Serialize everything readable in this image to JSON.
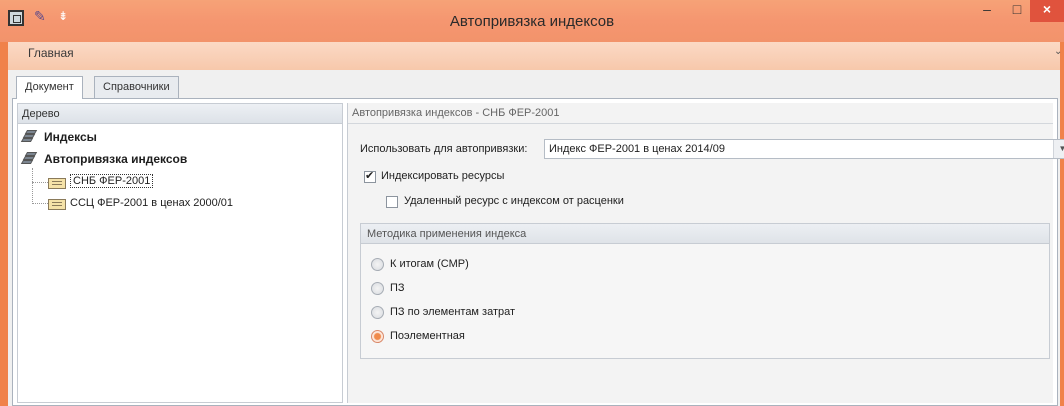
{
  "window": {
    "title": "Автопривязка индексов",
    "ribbon_tab": "Главная",
    "minimize": "–",
    "maximize": "□",
    "close": "×"
  },
  "doc_tabs": [
    {
      "label": "Документ",
      "active": true
    },
    {
      "label": "Справочники",
      "active": false
    }
  ],
  "tree": {
    "header": "Дерево",
    "nodes": [
      {
        "label": "Индексы",
        "bold": true
      },
      {
        "label": "Автопривязка индексов",
        "bold": true
      },
      {
        "label": "СНБ ФЕР-2001",
        "selected": true
      },
      {
        "label": "ССЦ ФЕР-2001 в ценах 2000/01",
        "selected": false
      }
    ]
  },
  "content": {
    "title": "Автопривязка индексов - СНБ ФЕР-2001",
    "use_label": "Использовать для автопривязки:",
    "use_value": "Индекс ФЕР-2001 в ценах 2014/09",
    "index_resources": {
      "label": "Индексировать ресурсы",
      "checked": true
    },
    "removed_resource": {
      "label": "Удаленный ресурс с индексом от расценки",
      "checked": false
    },
    "method": {
      "header": "Методика применения индекса",
      "options": [
        {
          "label": "К итогам (СМР)",
          "selected": false
        },
        {
          "label": "ПЗ",
          "selected": false
        },
        {
          "label": "ПЗ по элементам затрат",
          "selected": false
        },
        {
          "label": "Поэлементная",
          "selected": true
        }
      ]
    }
  },
  "colors": {
    "frame": "#f0824a",
    "titlebar": "#f59670",
    "close": "#e0533d"
  }
}
